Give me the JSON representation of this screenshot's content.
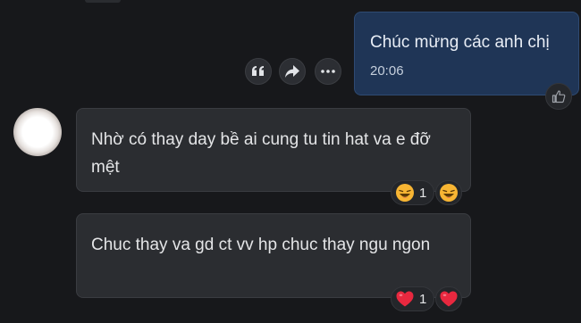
{
  "messages": {
    "self": {
      "text": "Chúc mừng các anh chị",
      "time": "20:06"
    },
    "incoming": [
      {
        "text": "Nhờ có thay day bề ai cung tu tin hat va e đỡ mệt",
        "reaction_count": "1",
        "reaction": "laughing-emoji"
      },
      {
        "text": "Chuc thay va gd ct vv hp chuc thay ngu ngon",
        "reaction_count": "1",
        "reaction": "heart-emoji"
      }
    ]
  },
  "actions": [
    "quote-icon",
    "forward-icon",
    "more-icon"
  ],
  "colors": {
    "background": "#17181b",
    "self_bubble": "#1f3556",
    "incoming_bubble": "#2b2d31",
    "heart": "#e8283f",
    "laugh": "#f7b533"
  }
}
